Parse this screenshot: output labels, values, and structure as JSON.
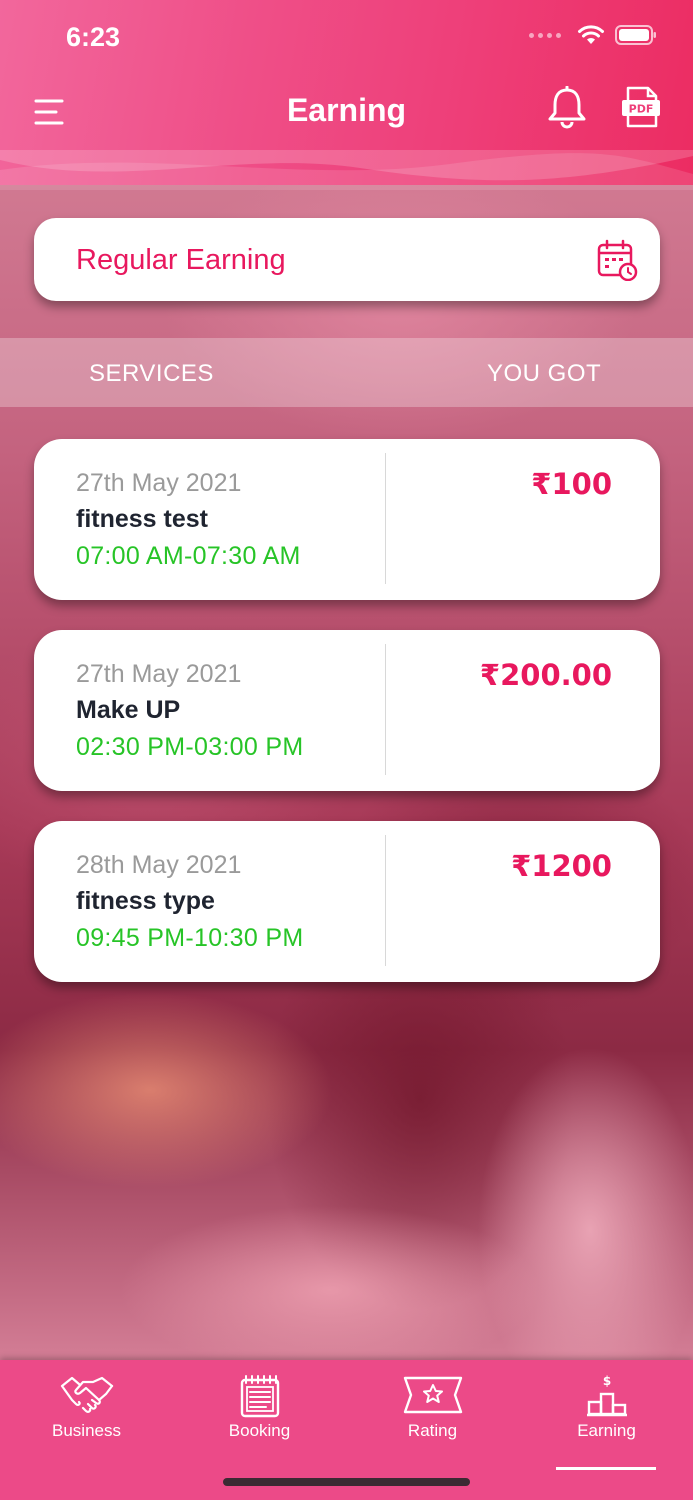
{
  "status_bar": {
    "time": "6:23"
  },
  "header": {
    "title": "Earning"
  },
  "earning_type": {
    "label": "Regular Earning"
  },
  "table_head": {
    "services": "SERVICES",
    "you_got": "YOU GOT"
  },
  "earnings": [
    {
      "date": "27th May 2021",
      "service": "fitness test",
      "time": "07:00 AM-07:30 AM",
      "amount": "₹100"
    },
    {
      "date": "27th May 2021",
      "service": "Make UP",
      "time": "02:30 PM-03:00 PM",
      "amount": "₹200.00"
    },
    {
      "date": "28th May 2021",
      "service": "fitness type",
      "time": "09:45 PM-10:30 PM",
      "amount": "₹1200"
    }
  ],
  "tabs": [
    {
      "label": "Business",
      "icon": "handshake-icon"
    },
    {
      "label": "Booking",
      "icon": "notepad-icon"
    },
    {
      "label": "Rating",
      "icon": "star-ticket-icon"
    },
    {
      "label": "Earning",
      "icon": "podium-dollar-icon",
      "active": true
    }
  ],
  "colors": {
    "accent": "#e8185e",
    "header": "#ee3f79",
    "time_green": "#27c427",
    "tabbar": "#ec4a88"
  }
}
